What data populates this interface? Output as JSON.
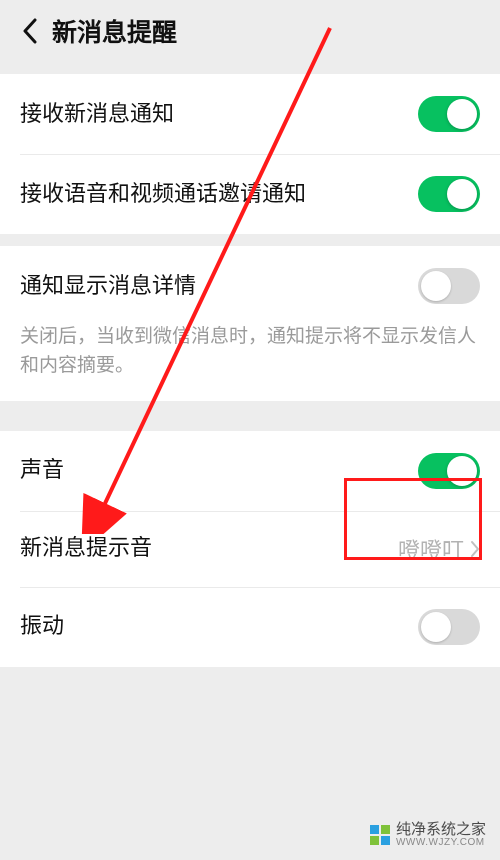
{
  "header": {
    "title": "新消息提醒"
  },
  "group1": {
    "row1": {
      "label": "接收新消息通知",
      "on": true
    },
    "row2": {
      "label": "接收语音和视频通话邀请通知",
      "on": true
    }
  },
  "group2": {
    "row": {
      "label": "通知显示消息详情",
      "on": false
    },
    "desc": "关闭后，当收到微信消息时，通知提示将不显示发信人和内容摘要。"
  },
  "group3": {
    "row1": {
      "label": "声音",
      "on": true
    },
    "row2": {
      "label": "新消息提示音",
      "value": "噔噔叮"
    },
    "row3": {
      "label": "振动",
      "on": false
    }
  },
  "watermark": {
    "title": "纯净系统之家",
    "sub": "WWW.WJZY.COM"
  },
  "colors": {
    "accent_on": "#07c160",
    "annotation": "#ff1a1a"
  }
}
